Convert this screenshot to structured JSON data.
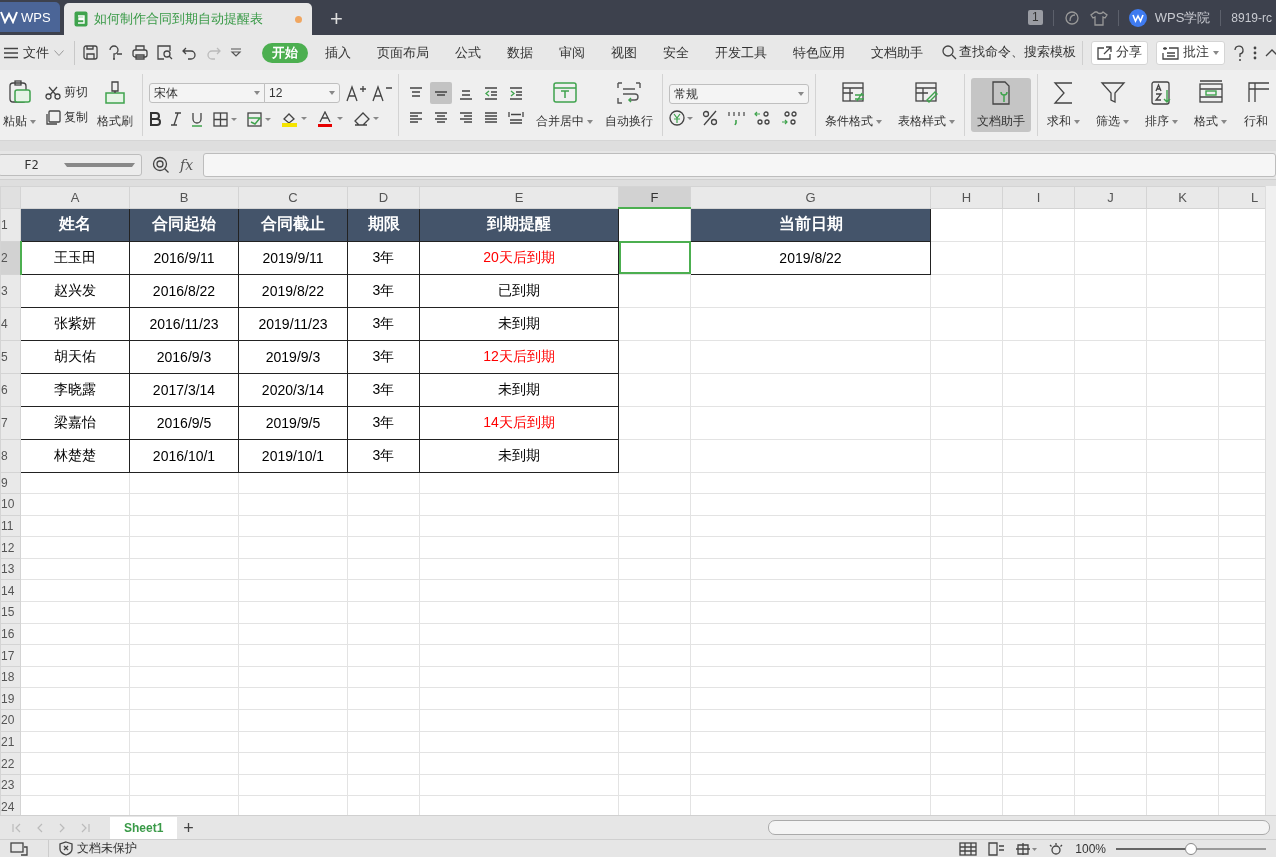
{
  "title_bar": {
    "app_tab": "WPS",
    "doc_tab": {
      "title": "如何制作合同到期自动提醒表",
      "unsaved": true,
      "selected": true
    },
    "new_tab": "+",
    "window_count": "1",
    "account": "WPS学院",
    "user": "8919-rc"
  },
  "menu": {
    "file": "文件",
    "tabs": [
      {
        "label": "开始",
        "selected": true
      },
      {
        "label": "插入",
        "selected": false
      },
      {
        "label": "页面布局",
        "selected": false
      },
      {
        "label": "公式",
        "selected": false
      },
      {
        "label": "数据",
        "selected": false
      },
      {
        "label": "审阅",
        "selected": false
      },
      {
        "label": "视图",
        "selected": false
      },
      {
        "label": "安全",
        "selected": false
      },
      {
        "label": "开发工具",
        "selected": false
      },
      {
        "label": "特色应用",
        "selected": false
      },
      {
        "label": "文档助手",
        "selected": false
      }
    ],
    "search": "查找命令、搜索模板",
    "share": "分享",
    "comment": "批注"
  },
  "ribbon": {
    "paste": "粘贴",
    "cut": "剪切",
    "copy": "复制",
    "format_painter": "格式刷",
    "font": "宋体",
    "font_size": "12",
    "alignment": [
      {
        "selected": false
      },
      {
        "selected": true
      },
      {
        "selected": false
      },
      {
        "selected": false
      },
      {
        "selected": false
      },
      {
        "selected": false
      },
      {
        "selected": false
      },
      {
        "selected": false
      },
      {
        "selected": false
      },
      {
        "selected": false
      }
    ],
    "merge": "合并居中",
    "wrap": "自动换行",
    "number_format": "常规",
    "conditional_format": "条件格式",
    "table_style": "表格样式",
    "doc_assistant": {
      "label": "文档助手",
      "selected": true
    },
    "sum": "求和",
    "filter": "筛选",
    "sort": "排序",
    "format": "格式",
    "rows_cols": "行和"
  },
  "formula_bar": {
    "name_box": "F2",
    "fx": "fx"
  },
  "sheet": {
    "columns": [
      {
        "label": "A",
        "selected": false
      },
      {
        "label": "B",
        "selected": false
      },
      {
        "label": "C",
        "selected": false
      },
      {
        "label": "D",
        "selected": false
      },
      {
        "label": "E",
        "selected": false
      },
      {
        "label": "F",
        "selected": true
      },
      {
        "label": "G",
        "selected": false
      },
      {
        "label": "H",
        "selected": false
      },
      {
        "label": "I",
        "selected": false
      },
      {
        "label": "J",
        "selected": false
      },
      {
        "label": "K",
        "selected": false
      },
      {
        "label": "L",
        "selected": false
      }
    ],
    "rows": [
      {
        "label": "1",
        "selected": false,
        "cells": [
          {
            "kind": "header",
            "text": "姓名",
            "selected": false
          },
          {
            "kind": "header",
            "text": "合同起始",
            "selected": false
          },
          {
            "kind": "header",
            "text": "合同截止",
            "selected": false
          },
          {
            "kind": "header",
            "text": "期限",
            "selected": false
          },
          {
            "kind": "header",
            "text": "到期提醒",
            "selected": false
          },
          {
            "kind": "empty",
            "selected": false
          },
          {
            "kind": "header",
            "text": "当前日期",
            "selected": false
          }
        ]
      },
      {
        "label": "2",
        "selected": true,
        "cells": [
          {
            "kind": "data",
            "text": "王玉田",
            "selected": false
          },
          {
            "kind": "data",
            "text": "2016/9/11",
            "selected": false
          },
          {
            "kind": "data",
            "text": "2019/9/11",
            "selected": false
          },
          {
            "kind": "data",
            "text": "3年",
            "selected": false
          },
          {
            "kind": "data",
            "text": "20天后到期",
            "color": "#ff0000",
            "selected": false
          },
          {
            "kind": "empty",
            "selected": true
          },
          {
            "kind": "data",
            "text": "2019/8/22",
            "selected": false
          }
        ]
      },
      {
        "label": "3",
        "selected": false,
        "cells": [
          {
            "kind": "data",
            "text": "赵兴发",
            "selected": false
          },
          {
            "kind": "data",
            "text": "2016/8/22",
            "selected": false
          },
          {
            "kind": "data",
            "text": "2019/8/22",
            "selected": false
          },
          {
            "kind": "data",
            "text": "3年",
            "selected": false
          },
          {
            "kind": "data",
            "text": "已到期",
            "selected": false
          }
        ]
      },
      {
        "label": "4",
        "selected": false,
        "cells": [
          {
            "kind": "data",
            "text": "张紫妍",
            "selected": false
          },
          {
            "kind": "data",
            "text": "2016/11/23",
            "selected": false
          },
          {
            "kind": "data",
            "text": "2019/11/23",
            "selected": false
          },
          {
            "kind": "data",
            "text": "3年",
            "selected": false
          },
          {
            "kind": "data",
            "text": "未到期",
            "selected": false
          }
        ]
      },
      {
        "label": "5",
        "selected": false,
        "cells": [
          {
            "kind": "data",
            "text": "胡天佑",
            "selected": false
          },
          {
            "kind": "data",
            "text": "2016/9/3",
            "selected": false
          },
          {
            "kind": "data",
            "text": "2019/9/3",
            "selected": false
          },
          {
            "kind": "data",
            "text": "3年",
            "selected": false
          },
          {
            "kind": "data",
            "text": "12天后到期",
            "color": "#ff0000",
            "selected": false
          }
        ]
      },
      {
        "label": "6",
        "selected": false,
        "cells": [
          {
            "kind": "data",
            "text": "李晓露",
            "selected": false
          },
          {
            "kind": "data",
            "text": "2017/3/14",
            "selected": false
          },
          {
            "kind": "data",
            "text": "2020/3/14",
            "selected": false
          },
          {
            "kind": "data",
            "text": "3年",
            "selected": false
          },
          {
            "kind": "data",
            "text": "未到期",
            "selected": false
          }
        ]
      },
      {
        "label": "7",
        "selected": false,
        "cells": [
          {
            "kind": "data",
            "text": "梁嘉怡",
            "selected": false
          },
          {
            "kind": "data",
            "text": "2016/9/5",
            "selected": false
          },
          {
            "kind": "data",
            "text": "2019/9/5",
            "selected": false
          },
          {
            "kind": "data",
            "text": "3年",
            "selected": false
          },
          {
            "kind": "data",
            "text": "14天后到期",
            "color": "#ff0000",
            "selected": false
          }
        ]
      },
      {
        "label": "8",
        "selected": false,
        "cells": [
          {
            "kind": "data",
            "text": "林楚楚",
            "selected": false
          },
          {
            "kind": "data",
            "text": "2016/10/1",
            "selected": false
          },
          {
            "kind": "data",
            "text": "2019/10/1",
            "selected": false
          },
          {
            "kind": "data",
            "text": "3年",
            "selected": false
          },
          {
            "kind": "data",
            "text": "未到期",
            "selected": false
          }
        ]
      },
      {
        "label": "9",
        "selected": false
      },
      {
        "label": "10",
        "selected": false
      },
      {
        "label": "11",
        "selected": false
      },
      {
        "label": "12",
        "selected": false
      },
      {
        "label": "13",
        "selected": false
      },
      {
        "label": "14",
        "selected": false
      },
      {
        "label": "15",
        "selected": false
      },
      {
        "label": "16",
        "selected": false
      },
      {
        "label": "17",
        "selected": false
      },
      {
        "label": "18",
        "selected": false
      },
      {
        "label": "19",
        "selected": false
      },
      {
        "label": "20",
        "selected": false
      },
      {
        "label": "21",
        "selected": false
      },
      {
        "label": "22",
        "selected": false
      },
      {
        "label": "23",
        "selected": false
      },
      {
        "label": "24",
        "selected": false
      }
    ]
  },
  "sheet_tabs": [
    {
      "label": "Sheet1",
      "selected": true
    }
  ],
  "add_sheet": "+",
  "status_bar": {
    "protection": "文档未保护",
    "zoom": "100%",
    "zoom_slider": {
      "level": 0.5
    }
  }
}
